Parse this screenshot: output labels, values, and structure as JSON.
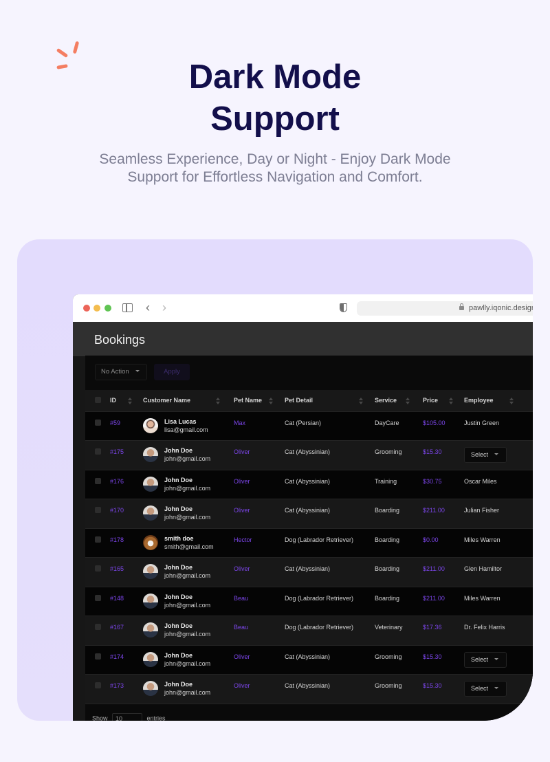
{
  "hero": {
    "title_line1": "Dark Mode",
    "title_line2": "Support",
    "subtitle_line1": "Seamless Experience, Day or Night - Enjoy Dark Mode",
    "subtitle_line2": "Support for Effortless Navigation and Comfort.",
    "accent_color": "#f47e62",
    "title_color": "#130f4b"
  },
  "browser": {
    "url": "pawlly.iqonic.design",
    "back_icon": "‹",
    "forward_icon": "›"
  },
  "app": {
    "page_title": "Bookings",
    "bulk_action": {
      "selected": "No Action",
      "apply_label": "Apply"
    },
    "accent_color": "#7b45e8",
    "table": {
      "columns": [
        "ID",
        "Customer Name",
        "Pet Name",
        "Pet Detail",
        "Service",
        "Price",
        "Employee"
      ],
      "rows": [
        {
          "id": "#59",
          "avatar": "lisa",
          "name": "Lisa Lucas",
          "email": "lisa@gmail.com",
          "pet": "Max",
          "detail": "Cat (Persian)",
          "service": "DayCare",
          "price": "$105.00",
          "employee": "Justin Green"
        },
        {
          "id": "#175",
          "avatar": "john",
          "name": "John Doe",
          "email": "john@gmail.com",
          "pet": "Oliver",
          "detail": "Cat (Abyssinian)",
          "service": "Grooming",
          "price": "$15.30",
          "employee": "Select",
          "employee_is_select": true
        },
        {
          "id": "#176",
          "avatar": "john",
          "name": "John Doe",
          "email": "john@gmail.com",
          "pet": "Oliver",
          "detail": "Cat (Abyssinian)",
          "service": "Training",
          "price": "$30.75",
          "employee": "Oscar Miles"
        },
        {
          "id": "#170",
          "avatar": "john",
          "name": "John Doe",
          "email": "john@gmail.com",
          "pet": "Oliver",
          "detail": "Cat (Abyssinian)",
          "service": "Boarding",
          "price": "$211.00",
          "employee": "Julian Fisher"
        },
        {
          "id": "#178",
          "avatar": "dog",
          "name": "smith doe",
          "email": "smith@gmail.com",
          "pet": "Hector",
          "detail": "Dog (Labrador Retriever)",
          "service": "Boarding",
          "price": "$0.00",
          "employee": "Miles Warren"
        },
        {
          "id": "#165",
          "avatar": "john",
          "name": "John Doe",
          "email": "john@gmail.com",
          "pet": "Oliver",
          "detail": "Cat (Abyssinian)",
          "service": "Boarding",
          "price": "$211.00",
          "employee": "Glen Hamiltor"
        },
        {
          "id": "#148",
          "avatar": "john",
          "name": "John Doe",
          "email": "john@gmail.com",
          "pet": "Beau",
          "detail": "Dog (Labrador Retriever)",
          "service": "Boarding",
          "price": "$211.00",
          "employee": "Miles Warren"
        },
        {
          "id": "#167",
          "avatar": "john",
          "name": "John Doe",
          "email": "john@gmail.com",
          "pet": "Beau",
          "detail": "Dog (Labrador Retriever)",
          "service": "Veterinary",
          "price": "$17.36",
          "employee": "Dr. Felix Harris"
        },
        {
          "id": "#174",
          "avatar": "john",
          "name": "John Doe",
          "email": "john@gmail.com",
          "pet": "Oliver",
          "detail": "Cat (Abyssinian)",
          "service": "Grooming",
          "price": "$15.30",
          "employee": "Select",
          "employee_is_select": true
        },
        {
          "id": "#173",
          "avatar": "john",
          "name": "John Doe",
          "email": "john@gmail.com",
          "pet": "Oliver",
          "detail": "Cat (Abyssinian)",
          "service": "Grooming",
          "price": "$15.30",
          "employee": "Select",
          "employee_is_select": true
        }
      ]
    },
    "footer": {
      "show_label": "Show",
      "page_length": "10",
      "entries_label": "entries"
    }
  }
}
